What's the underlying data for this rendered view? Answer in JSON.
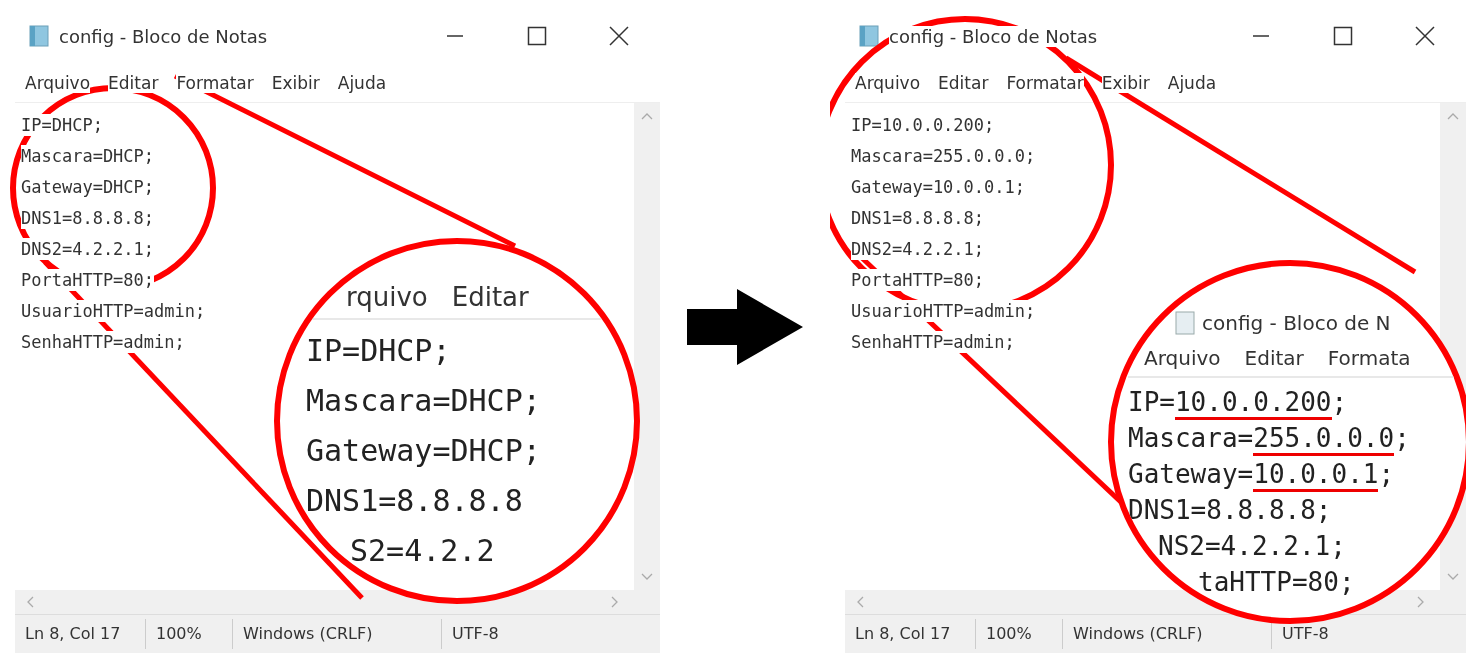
{
  "panels": [
    {
      "window": {
        "title": "config - Bloco de Notas"
      },
      "menu": [
        "Arquivo",
        "Editar",
        "Formatar",
        "Exibir",
        "Ajuda"
      ],
      "lines": [
        "IP=DHCP;",
        "Mascara=DHCP;",
        "Gateway=DHCP;",
        "DNS1=8.8.8.8;",
        "DNS2=4.2.2.1;",
        "PortaHTTP=80;",
        "UsuarioHTTP=admin;",
        "SenhaHTTP=admin;"
      ],
      "status_bar": [
        "Ln 8, Col 17",
        "100%",
        "Windows (CRLF)",
        "UTF-8"
      ],
      "magnifier": {
        "menu": [
          "rquivo",
          "Editar"
        ],
        "lines": [
          {
            "before": "IP=DHCP;"
          },
          {
            "before": "Mascara=DHCP;"
          },
          {
            "before": "Gateway=DHCP;"
          },
          {
            "before": "DNS1=8.8.8.8"
          },
          {
            "before": "S2=4.2.2"
          }
        ]
      }
    },
    {
      "window": {
        "title": "config - Bloco de Notas"
      },
      "menu": [
        "Arquivo",
        "Editar",
        "Formatar",
        "Exibir",
        "Ajuda"
      ],
      "lines": [
        "IP=10.0.0.200;",
        "Mascara=255.0.0.0;",
        "Gateway=10.0.0.1;",
        "DNS1=8.8.8.8;",
        "DNS2=4.2.2.1;",
        "PortaHTTP=80;",
        "UsuarioHTTP=admin;",
        "SenhaHTTP=admin;"
      ],
      "status_bar": [
        "Ln 8, Col 17",
        "100%",
        "Windows (CRLF)",
        "UTF-8"
      ],
      "magnifier": {
        "title": "config - Bloco de N",
        "menu": [
          "Arquivo",
          "Editar",
          "Formata"
        ],
        "lines": [
          {
            "before": "IP=",
            "mark": "10.0.0.200",
            "after": ";"
          },
          {
            "before": "Mascara=",
            "mark": "255.0.0.0",
            "after": ";"
          },
          {
            "before": "Gateway=",
            "mark": "10.0.0.1",
            "after": ";"
          },
          {
            "before": "DNS1=8.8.8.8;"
          },
          {
            "before": "NS2=4.2.2.1;"
          },
          {
            "before": "taHTTP=80;"
          }
        ]
      }
    }
  ]
}
